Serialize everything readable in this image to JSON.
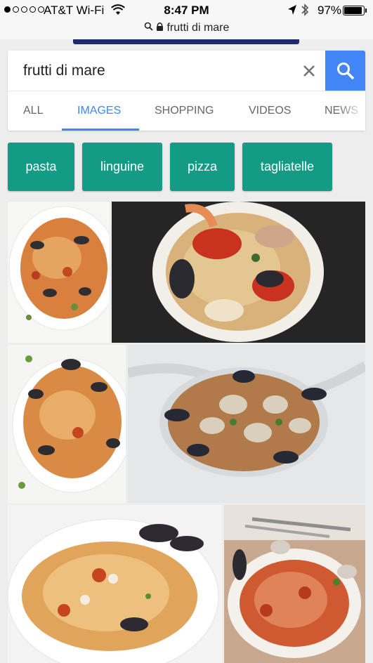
{
  "status": {
    "carrier": "AT&T Wi-Fi",
    "time": "8:47 PM",
    "battery": "97%"
  },
  "url_bar": {
    "text": "frutti di mare"
  },
  "search": {
    "query": "frutti di mare"
  },
  "tabs": [
    {
      "label": "ALL"
    },
    {
      "label": "IMAGES"
    },
    {
      "label": "SHOPPING"
    },
    {
      "label": "VIDEOS"
    },
    {
      "label": "NEWS"
    }
  ],
  "chips": [
    {
      "label": "pasta"
    },
    {
      "label": "linguine"
    },
    {
      "label": "pizza"
    },
    {
      "label": "tagliatelle"
    }
  ],
  "colors": {
    "accent": "#4285f4",
    "chip": "#139b85"
  },
  "icons": [
    "location-arrow-icon",
    "bluetooth-icon",
    "wifi-icon",
    "lock-icon",
    "close-icon",
    "search-icon"
  ]
}
